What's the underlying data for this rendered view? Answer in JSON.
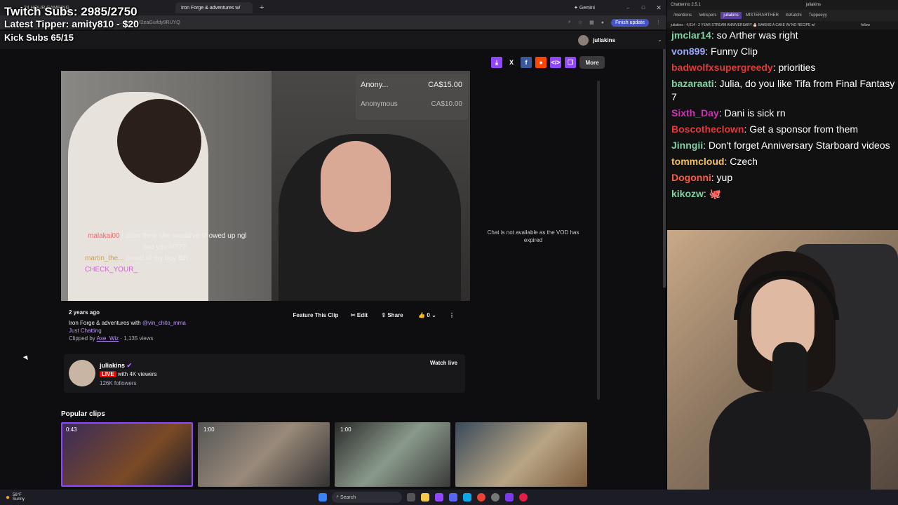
{
  "overlay": {
    "twitch_subs": "Twitch Subs: 2985/2750",
    "latest_tipper": "Latest Tipper: amity810 - $20",
    "kick_subs": "Kick Subs 65/15"
  },
  "browser": {
    "tabs": [
      "24 HOUR CAMPING",
      "Iron Forge & adventures w/"
    ],
    "url": "...ofer-EM2eaGuifdy9RUYQ",
    "gemini_label": "Gemini",
    "finish_update_label": "Finish update"
  },
  "twitch": {
    "username": "juliakins",
    "share_more_label": "More",
    "donations": [
      {
        "name": "Anony...",
        "amount": "CA$15.00"
      },
      {
        "name": "Anonymous",
        "amount": "CA$10.00"
      }
    ],
    "video_chat": [
      {
        "user": "malakai00",
        "text": "i didnt think she would've showed up ngl"
      },
      {
        "user": "",
        "text": "bro you lit???"
      },
      {
        "user": "martin_the...",
        "text": "proud of my boy tbh"
      },
      {
        "user": "CHECK_YOUR_",
        "text": ""
      }
    ],
    "vod_chat_notice": "Chat is not available as the VOD has expired",
    "clip": {
      "age": "2 years ago",
      "title_prefix": "Iron Forge & adventures with",
      "title_mention": "@vin_chito_mma",
      "category": "Just Chatting",
      "clipped_by_label": "Clipped by",
      "clipped_by": "Axe_Wiz",
      "views": "1,135 views",
      "feature_label": "Feature This Clip",
      "edit_label": "Edit",
      "share_label": "Share",
      "likes": "0"
    },
    "channel": {
      "name": "juliakins",
      "live_label": "LIVE",
      "viewers": "with 4K viewers",
      "followers": "126K followers",
      "watch_live_label": "Watch live"
    },
    "popular_clips_label": "Popular clips",
    "popular_clips": [
      {
        "duration": "0:43"
      },
      {
        "duration": "1:00"
      },
      {
        "duration": "1:00"
      },
      {
        "duration": ""
      }
    ]
  },
  "chatterino": {
    "title": "Chatterino 2.5.1",
    "account": "juliakins",
    "tabs": [
      "/mentions",
      "/whispers",
      "juliakins",
      "MISTERARTHER",
      "itsKatchi",
      "Tuppeeyy"
    ],
    "header": "juliakins - 4,014 - 2 YEAR STREAM ANNIVERSARY 🎂 BAKING A CAKE W/ NO RECIPE w/",
    "follow_label": "follow",
    "messages": [
      {
        "user": "jmclar14",
        "color": "#7fd1a1",
        "text": "so Arther was right"
      },
      {
        "user": "von899",
        "color": "#9aa7ff",
        "text": "Funny Clip"
      },
      {
        "user": "badwolfxsupergreedy",
        "color": "#e03a3a",
        "text": "priorities"
      },
      {
        "user": "bazaraati",
        "color": "#7fd1a1",
        "text": "Julia, do you like Tifa from Final Fantasy 7"
      },
      {
        "user": "Sixth_Day",
        "color": "#d230b8",
        "text": "Dani is sick rn"
      },
      {
        "user": "Boscotheclown",
        "color": "#e03a3a",
        "text": "Get a sponsor from them"
      },
      {
        "user": "Jinngii",
        "color": "#7fd1a1",
        "text": "Don't forget Anniversary Starboard videos"
      },
      {
        "user": "tommcloud",
        "color": "#f0c060",
        "text": "Czech"
      },
      {
        "user": "Dogonni",
        "color": "#ff5a3c",
        "text": "yup"
      },
      {
        "user": "kikozw",
        "color": "#7fd1a1",
        "text": ""
      }
    ]
  },
  "taskbar": {
    "weather_temp": "56°F",
    "weather_desc": "Sunny",
    "search_label": "Search"
  }
}
